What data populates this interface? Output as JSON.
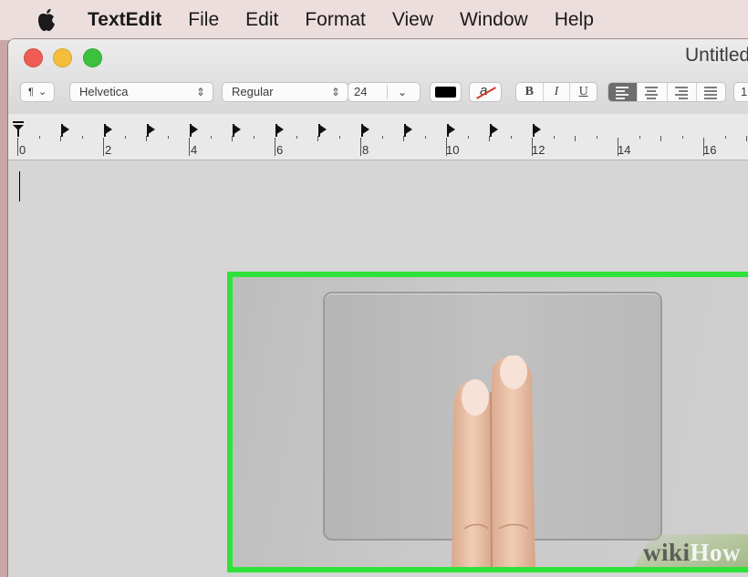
{
  "menubar": {
    "apple_icon": "apple-logo-icon",
    "app_name": "TextEdit",
    "items": [
      "File",
      "Edit",
      "Format",
      "View",
      "Window",
      "Help"
    ]
  },
  "window": {
    "title": "Untitled",
    "traffic_lights": {
      "close": "#ef5c55",
      "minimize": "#f5bd3c",
      "zoom": "#3cc13f"
    }
  },
  "toolbar": {
    "paragraph_style_glyph": "¶",
    "font_family_value": "Helvetica",
    "typeface_value": "Regular",
    "font_size_value": "24",
    "text_color": "#000000",
    "highlight_glyph": "a",
    "bold_label": "B",
    "italic_label": "I",
    "underline_label": "U",
    "alignment_selected": "left",
    "line_spacing_value": "1."
  },
  "ruler": {
    "labels": [
      "0",
      "2",
      "4",
      "6",
      "8",
      "10",
      "12",
      "14",
      "16"
    ]
  },
  "photo": {
    "border_color": "#2fe23a",
    "description_icon": "two-finger-trackpad-gesture",
    "watermark_wiki": "wiki",
    "watermark_how": "How"
  }
}
